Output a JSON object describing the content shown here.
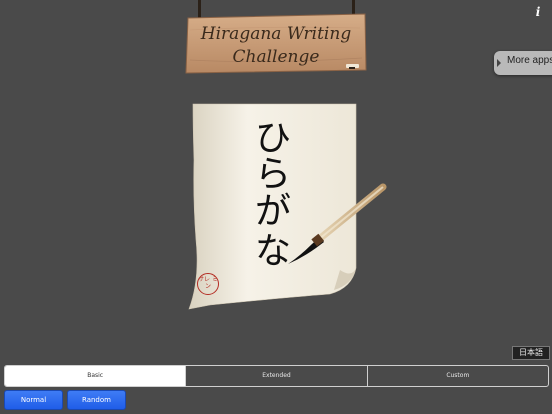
{
  "header": {
    "title_line1": "Hiragana Writing",
    "title_line2": "Challenge",
    "info_label": "i"
  },
  "more_apps": {
    "label": "More apps"
  },
  "scroll": {
    "characters": [
      "ひ",
      "ら",
      "が",
      "な"
    ],
    "stamp_text": "サレ ミン"
  },
  "language_button": {
    "label": "日本語"
  },
  "segments": [
    {
      "label": "Basic",
      "selected": true
    },
    {
      "label": "Extended",
      "selected": false
    },
    {
      "label": "Custom",
      "selected": false
    }
  ],
  "mode_buttons": {
    "normal_label": "Normal",
    "random_label": "Random"
  },
  "colors": {
    "background": "#4a4a4a",
    "sign_wood": "#c89c78",
    "paper": "#f1ecdf",
    "stamp_red": "#b42c23",
    "button_blue": "#2a6cf0"
  }
}
